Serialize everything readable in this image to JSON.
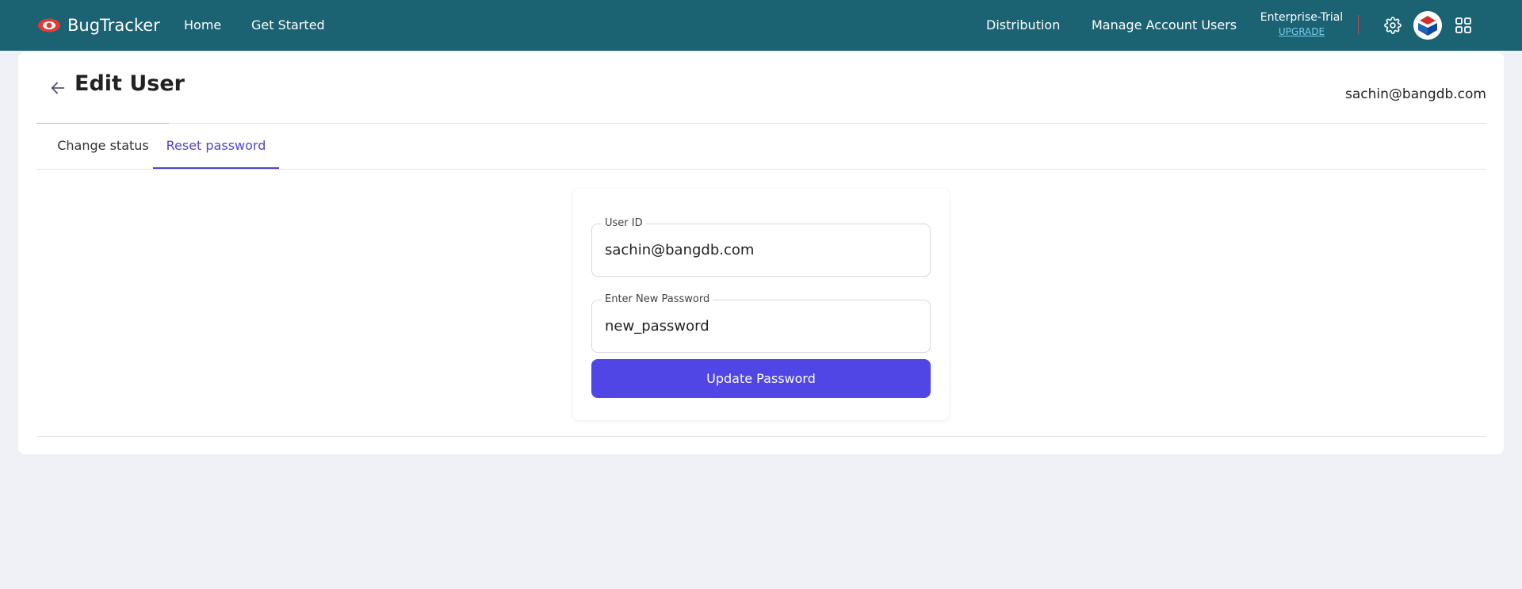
{
  "app": {
    "name": "BugTracker",
    "logo_icon": "eye-logo-icon",
    "brand_color": "#1b6272",
    "logo_color": "#e53935"
  },
  "topnav": {
    "left_links": [
      "Home",
      "Get Started"
    ],
    "right_links": [
      "Distribution",
      "Manage Account Users"
    ],
    "plan": {
      "name": "Enterprise-Trial",
      "upgrade_label": "UPGRADE"
    },
    "icons": {
      "settings": "gear-icon",
      "avatar": "user-avatar",
      "apps": "grid-apps-icon"
    }
  },
  "page": {
    "title": "Edit User",
    "back_icon": "arrow-left-icon",
    "user_email": "sachin@bangdb.com"
  },
  "tabs": [
    {
      "label": "Change status",
      "active": false
    },
    {
      "label": "Reset password",
      "active": true
    }
  ],
  "form": {
    "user_id": {
      "label": "User ID",
      "value": "sachin@bangdb.com"
    },
    "new_password": {
      "label": "Enter New Password",
      "value": "new_password"
    },
    "submit_label": "Update Password"
  },
  "colors": {
    "accent": "#4f46e5",
    "tab_active": "#5145c9",
    "upgrade_link": "#7cc9ec",
    "page_background": "#f0f1f6"
  }
}
